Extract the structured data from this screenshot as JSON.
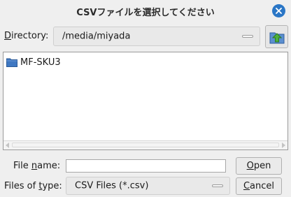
{
  "window": {
    "title": "CSVファイルを選択してください"
  },
  "directory": {
    "label_prefix": "D",
    "label_rest": "irectory:",
    "path": "/media/miyada"
  },
  "files": [
    {
      "name": "MF-SKU3",
      "type": "folder"
    }
  ],
  "filename": {
    "label_pre": "File ",
    "label_ul": "n",
    "label_post": "ame:",
    "value": ""
  },
  "filetype": {
    "label_pre": "Files of ",
    "label_ul": "t",
    "label_post": "ype:",
    "selected": "CSV Files (*.csv)"
  },
  "buttons": {
    "open_ul": "O",
    "open_rest": "pen",
    "cancel_ul": "C",
    "cancel_rest": "ancel"
  },
  "colors": {
    "accent": "#2a76c6",
    "folder": "#3f78c2",
    "up_arrow": "#4caf3a"
  }
}
